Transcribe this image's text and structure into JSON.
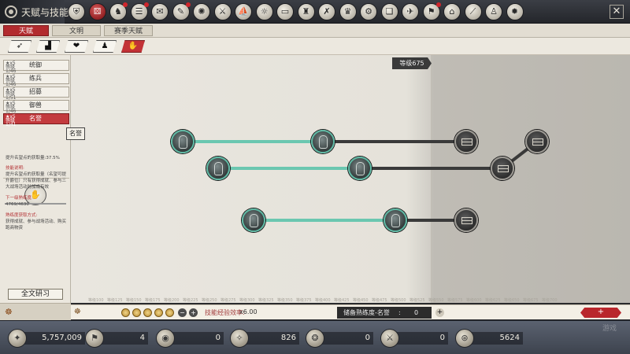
{
  "header": {
    "title": "天赋与技能",
    "close_label": "✕",
    "icons": [
      {
        "name": "shield",
        "glyph": "⛨",
        "active": false,
        "dot": false
      },
      {
        "name": "dice",
        "glyph": "⚄",
        "active": true,
        "dot": false
      },
      {
        "name": "horse-head",
        "glyph": "♞",
        "active": false,
        "dot": true
      },
      {
        "name": "scroll",
        "glyph": "☰",
        "active": false,
        "dot": true
      },
      {
        "name": "envelope",
        "glyph": "✉",
        "active": false,
        "dot": false
      },
      {
        "name": "quill",
        "glyph": "✎",
        "active": false,
        "dot": true
      },
      {
        "name": "compass",
        "glyph": "✺",
        "active": false,
        "dot": false
      },
      {
        "name": "sword-circle",
        "glyph": "⚔",
        "active": false,
        "dot": false
      },
      {
        "name": "boat",
        "glyph": "⛵",
        "active": false,
        "dot": false
      },
      {
        "name": "sun",
        "glyph": "☼",
        "active": false,
        "dot": false
      },
      {
        "name": "tablet",
        "glyph": "▭",
        "active": false,
        "dot": false
      },
      {
        "name": "castle",
        "glyph": "♜",
        "active": false,
        "dot": false
      },
      {
        "name": "crossed-arrows",
        "glyph": "✗",
        "active": false,
        "dot": false
      },
      {
        "name": "crown",
        "glyph": "♛",
        "active": false,
        "dot": false
      },
      {
        "name": "gear-wheel",
        "glyph": "⚙",
        "active": false,
        "dot": false
      },
      {
        "name": "book-red",
        "glyph": "❏",
        "active": false,
        "dot": false
      },
      {
        "name": "bird",
        "glyph": "✈",
        "active": false,
        "dot": false
      },
      {
        "name": "banner",
        "glyph": "⚑",
        "active": false,
        "dot": true
      },
      {
        "name": "tag",
        "glyph": "⌂",
        "active": false,
        "dot": false
      },
      {
        "name": "spear",
        "glyph": "⟋",
        "active": false,
        "dot": false
      },
      {
        "name": "warrior",
        "glyph": "♙",
        "active": false,
        "dot": false
      },
      {
        "name": "sun-seal",
        "glyph": "✹",
        "active": false,
        "dot": false
      }
    ]
  },
  "tabs": [
    {
      "label": "天赋",
      "active": true
    },
    {
      "label": "文明",
      "active": false
    },
    {
      "label": "赛季天赋",
      "active": false
    }
  ],
  "subtabs": [
    {
      "name": "bow",
      "glyph": "➶",
      "active": false
    },
    {
      "name": "boot",
      "glyph": "▟",
      "active": false
    },
    {
      "name": "heart",
      "glyph": "❤",
      "active": false
    },
    {
      "name": "bust",
      "glyph": "♟",
      "active": false
    },
    {
      "name": "seal-hand",
      "glyph": "✋",
      "active": true
    }
  ],
  "categories": [
    {
      "label": "统御",
      "tag": "★x5 等级1/46",
      "active": false
    },
    {
      "label": "练兵",
      "tag": "★x5 等级1/46",
      "active": false
    },
    {
      "label": "招募",
      "tag": "★x5 等级1/51",
      "active": false
    },
    {
      "label": "御兽",
      "tag": "★x5 等级1/46",
      "active": false
    },
    {
      "label": "名誉",
      "tag": "★x5 等级1/41",
      "active": true
    }
  ],
  "panel": {
    "badge_glyph": "✋",
    "skill_name": "名誉",
    "desc1": "提升名望点的获取量:37.5%",
    "desc_title": "技能说明:",
    "desc_body": "提升名望点的获取量（名望可提升爵位）只有获得成就、参与三大战场活动时加成有效",
    "next_title": "下一级熟练度:",
    "next_value": "4769/4630",
    "source_title": "熟练度获取方式:",
    "source_body": "获得成就、参与战场活动、购买跑商物资",
    "research_label": "全文研习"
  },
  "tree": {
    "level_flag": "等级675"
  },
  "level_ticks": [
    "等级100",
    "等级125",
    "等级150",
    "等级175",
    "等级200",
    "等级225",
    "等级250",
    "等级275",
    "等级300",
    "等级325",
    "等级350",
    "等级375",
    "等级400",
    "等级425",
    "等级450",
    "等级475",
    "等级500",
    "等级525",
    "等级550",
    "等级575",
    "等级600",
    "等级625",
    "等级650",
    "等级675",
    "等级700"
  ],
  "exp_bar": {
    "efficiency_label": "技能经验效率:",
    "efficiency_value": "x6.00",
    "store_label": "储备熟练度-名誉",
    "store_colon": ":",
    "store_value": "0",
    "add_label": "+",
    "red_plus": "+"
  },
  "resources": [
    {
      "name": "silver",
      "glyph": "✦",
      "value": "5,757,009"
    },
    {
      "name": "banner",
      "glyph": "⚑",
      "value": "4"
    },
    {
      "name": "bronze-coin",
      "glyph": "◉",
      "value": "0"
    },
    {
      "name": "rune",
      "glyph": "✧",
      "value": "826"
    },
    {
      "name": "swirl",
      "glyph": "❂",
      "value": "0"
    },
    {
      "name": "sword",
      "glyph": "⚔",
      "value": "0"
    },
    {
      "name": "gold-coin",
      "glyph": "⊛",
      "value": "5624"
    }
  ],
  "watermark": "游戏"
}
